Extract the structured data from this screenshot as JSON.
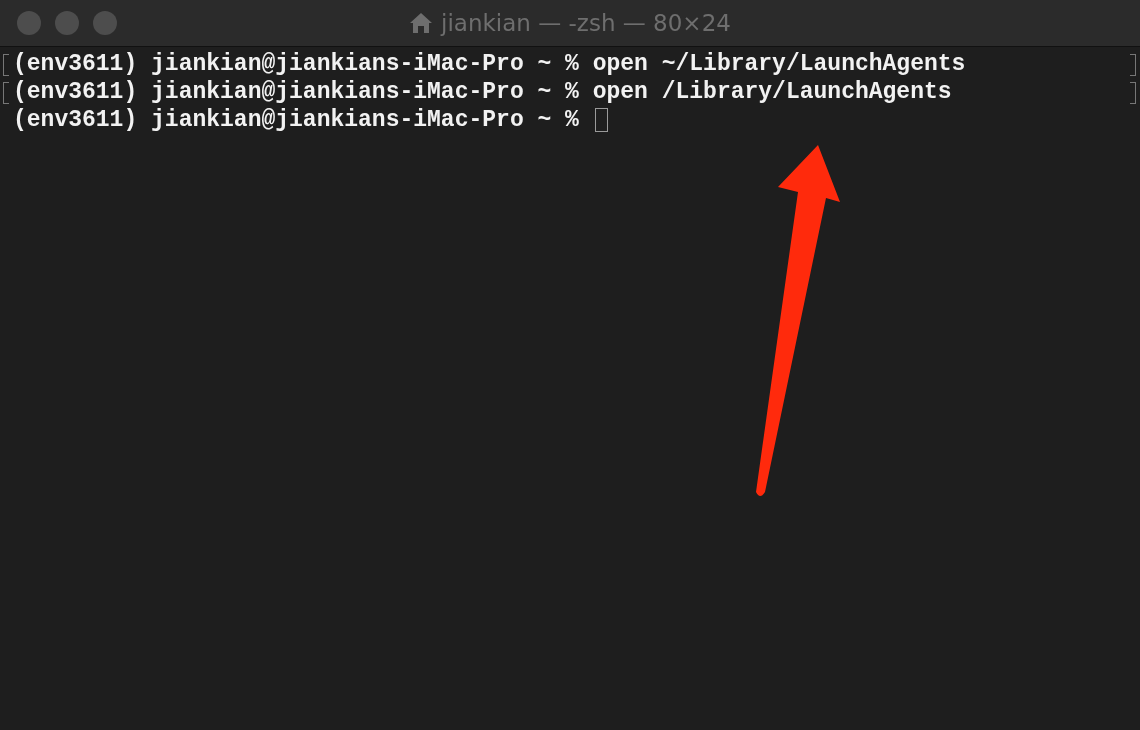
{
  "window": {
    "title": "jiankian — -zsh — 80×24",
    "focused": false
  },
  "lines": [
    {
      "text": "(env3611) jiankian@jiankians-iMac-Pro ~ % open ~/Library/LaunchAgents",
      "marked": true,
      "cursor": false
    },
    {
      "text": "(env3611) jiankian@jiankians-iMac-Pro ~ % open /Library/LaunchAgents",
      "marked": true,
      "cursor": false
    },
    {
      "text": "(env3611) jiankian@jiankians-iMac-Pro ~ % ",
      "marked": false,
      "cursor": true
    }
  ]
}
